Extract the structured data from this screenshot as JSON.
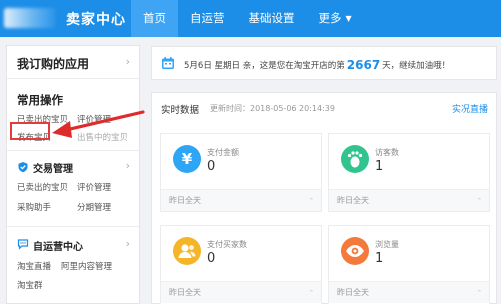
{
  "header": {
    "title": "卖家中心",
    "nav": [
      {
        "label": "首页",
        "active": true
      },
      {
        "label": "自运营",
        "active": false
      },
      {
        "label": "基础设置",
        "active": false
      },
      {
        "label": "更多",
        "active": false
      }
    ]
  },
  "sidebar": {
    "my_apps_title": "我订购的应用",
    "common_title": "常用操作",
    "common_links": [
      "已卖出的宝贝",
      "评价管理",
      "发布宝贝",
      "出售中的宝贝"
    ],
    "trade": {
      "title": "交易管理",
      "links": [
        "已卖出的宝贝",
        "评价管理",
        "采购助手",
        "分期管理"
      ]
    },
    "self_op": {
      "title": "自运营中心",
      "links": [
        "淘宝直播",
        "阿里内容管理",
        "淘宝群"
      ]
    }
  },
  "banner": {
    "date": "5月6日",
    "weekday": "星期日",
    "text_before": "亲，这是您在淘宝开店的第",
    "days": "2667",
    "text_after": "天，继续加油哦！"
  },
  "realtime": {
    "title": "实时数据",
    "updated_label": "更新时间：",
    "updated_time": "2018-05-06 20:14:39",
    "live_link": "实况直播",
    "cards": [
      {
        "label": "支付金额",
        "value": "0",
        "footer": "昨日全天",
        "footer_value": "-",
        "icon": "yen-icon",
        "color": "#2fa6f5"
      },
      {
        "label": "访客数",
        "value": "1",
        "footer": "昨日全天",
        "footer_value": "-",
        "icon": "footprint-icon",
        "color": "#32c48f"
      },
      {
        "label": "支付买家数",
        "value": "0",
        "footer": "昨日全天",
        "footer_value": "-",
        "icon": "buyer-icon",
        "color": "#f5b528"
      },
      {
        "label": "浏览量",
        "value": "1",
        "footer": "昨日全天",
        "footer_value": "-",
        "icon": "eye-icon",
        "color": "#f47a3c"
      }
    ]
  }
}
